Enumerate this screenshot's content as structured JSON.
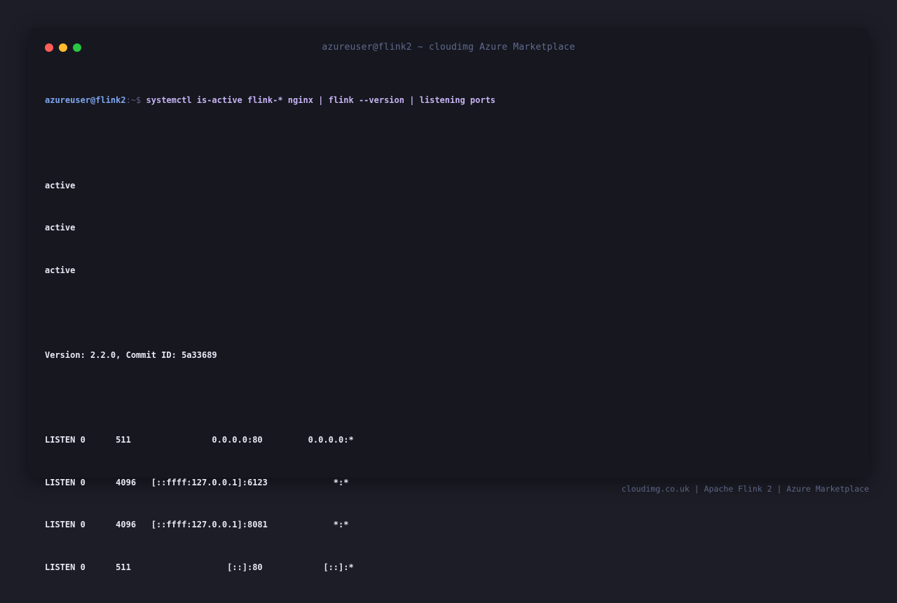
{
  "window": {
    "title": "azureuser@flink2 ~ cloudimg Azure Marketplace",
    "controls": [
      {
        "name": "close",
        "color": "#ff5f57"
      },
      {
        "name": "minimize",
        "color": "#febc2e"
      },
      {
        "name": "maximize",
        "color": "#28c840"
      }
    ]
  },
  "terminal": {
    "prompt": {
      "user_host": "azureuser@flink2",
      "path_symbol": ":~$",
      "command": "systemctl is-active flink-* nginx | flink --version | listening ports"
    },
    "status_lines": [
      "active",
      "active",
      "active"
    ],
    "version_line": "Version: 2.2.0, Commit ID: 5a33689",
    "listen_rows": [
      "LISTEN 0      511                0.0.0.0:80         0.0.0.0:*",
      "LISTEN 0      4096   [::ffff:127.0.0.1]:6123             *:*",
      "LISTEN 0      4096   [::ffff:127.0.0.1]:8081             *:*",
      "LISTEN 0      511                   [::]:80            [::]:*"
    ]
  },
  "footer": {
    "text": "cloudimg.co.uk | Apache Flink 2 | Azure Marketplace"
  },
  "colors": {
    "background": "#1c1d26",
    "window": "#16171f",
    "prompt_user": "#7ea6ef",
    "command": "#c6b3f3",
    "output": "#e6e9f4",
    "muted": "#5f6b8e"
  }
}
